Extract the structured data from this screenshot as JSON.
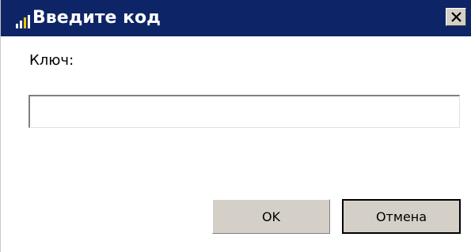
{
  "window": {
    "title": "Введите код",
    "title_bar_color": "#0d2466",
    "app_icon": "bar-chart-icon",
    "close_icon": "close-icon"
  },
  "form": {
    "key_label": "Ключ:",
    "key_value": ""
  },
  "buttons": {
    "ok_label": "OK",
    "cancel_label": "Отмена"
  }
}
